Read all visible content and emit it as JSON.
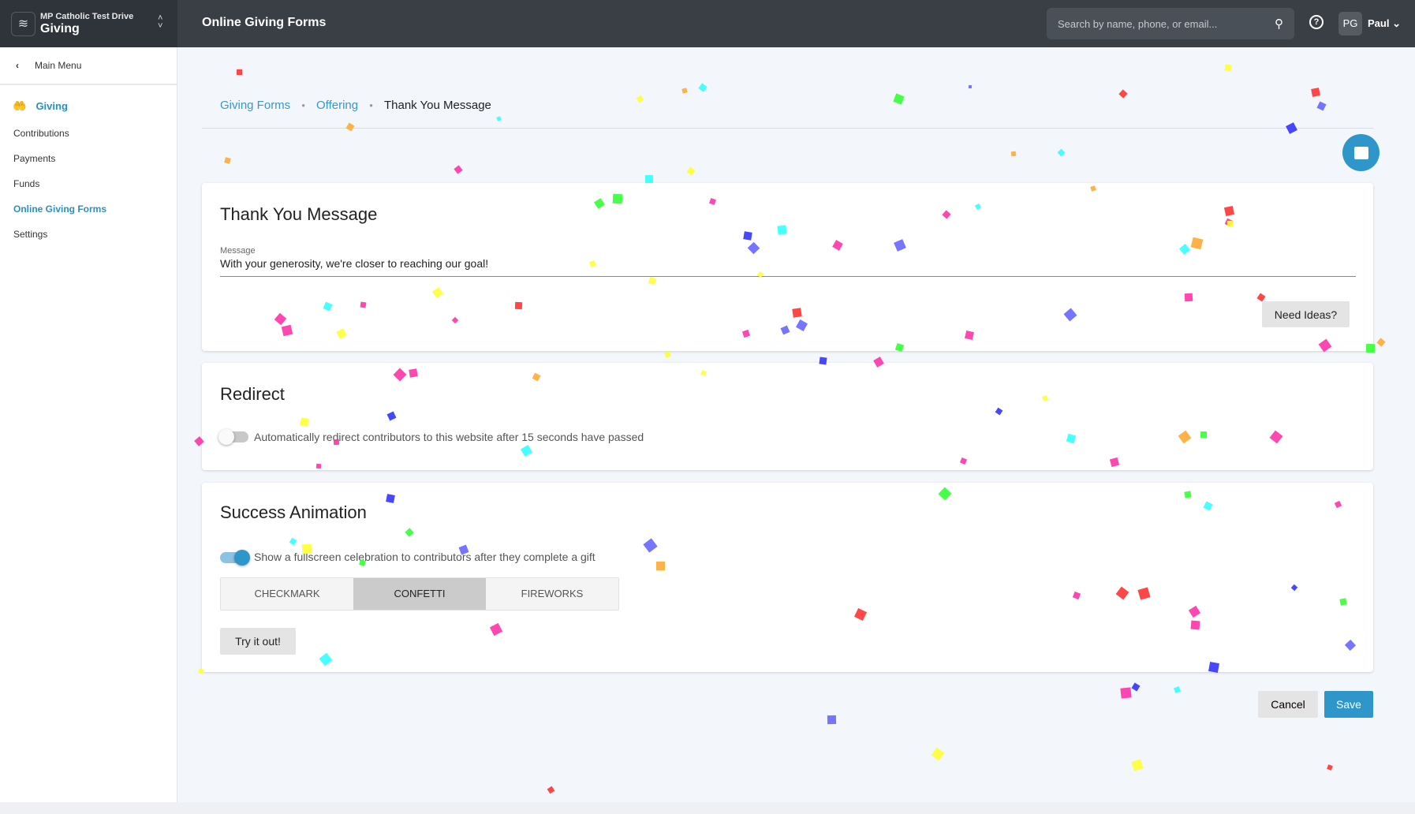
{
  "header": {
    "org": "MP Catholic Test Drive",
    "app": "Giving",
    "title": "Online Giving Forms",
    "search_placeholder": "Search by name, phone, or email...",
    "avatar_initials": "PG",
    "user_name": "Paul"
  },
  "sidebar": {
    "main_menu": "Main Menu",
    "section": "Giving",
    "items": [
      {
        "label": "Contributions"
      },
      {
        "label": "Payments"
      },
      {
        "label": "Funds"
      },
      {
        "label": "Online Giving Forms",
        "active": true
      },
      {
        "label": "Settings"
      }
    ]
  },
  "breadcrumb": [
    "Giving Forms",
    "Offering",
    "Thank You Message"
  ],
  "thank_you": {
    "title": "Thank You Message",
    "field_label": "Message",
    "message": "With your generosity, we're closer to reaching our goal!",
    "ideas_button": "Need Ideas?"
  },
  "redirect": {
    "title": "Redirect",
    "toggle_on": false,
    "label": "Automatically redirect contributors to this website after 15 seconds have passed"
  },
  "animation": {
    "title": "Success Animation",
    "toggle_on": true,
    "label": "Show a fullscreen celebration to contributors after they complete a gift",
    "options": [
      "CHECKMARK",
      "CONFETTI",
      "FIREWORKS"
    ],
    "selected": "CONFETTI",
    "try_button": "Try it out!"
  },
  "actions": {
    "cancel": "Cancel",
    "save": "Save"
  },
  "colors": {
    "accent": "#2f96c9",
    "topbar": "#3a3f46",
    "confetti": [
      "#ff3333",
      "#3333ff",
      "#33ff33",
      "#ffff33",
      "#33ffff",
      "#ff33aa",
      "#ffaa33",
      "#6666ff"
    ]
  }
}
